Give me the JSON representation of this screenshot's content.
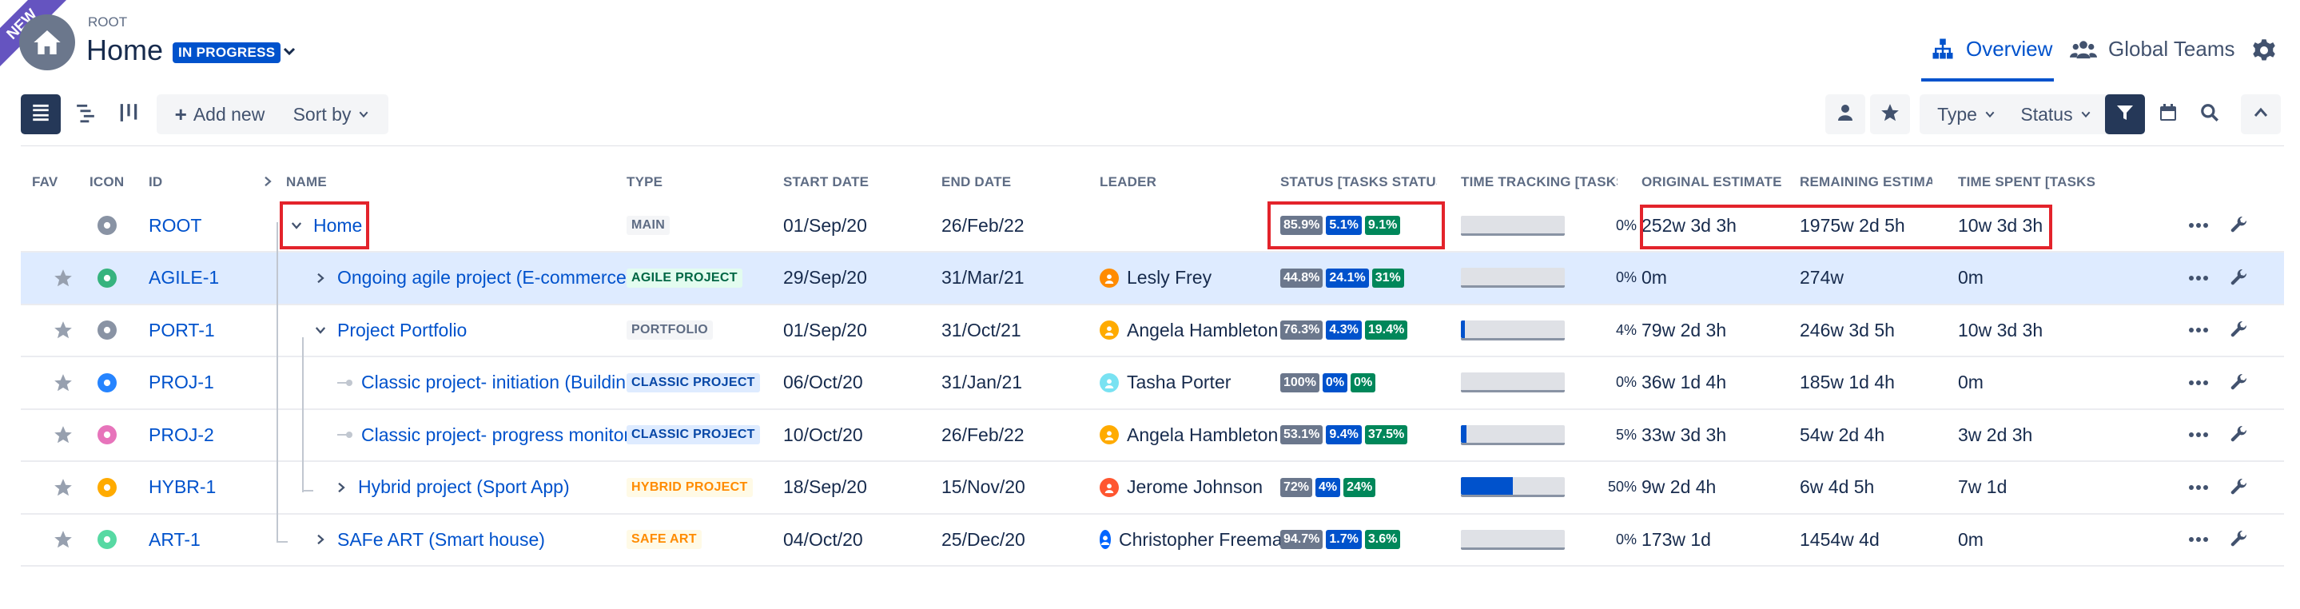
{
  "ribbon": {
    "label": "NEW"
  },
  "header": {
    "breadcrumb": "ROOT",
    "title": "Home",
    "status": "IN PROGRESS",
    "tabs": {
      "overview": "Overview",
      "global_teams": "Global Teams"
    }
  },
  "toolbar": {
    "add_new": "Add new",
    "sort_by": "Sort by",
    "type": "Type",
    "status": "Status"
  },
  "table": {
    "headers": {
      "fav": "FAV",
      "icon": "ICON",
      "id": "ID",
      "name": "NAME",
      "type": "TYPE",
      "start_date": "START DATE",
      "end_date": "END DATE",
      "leader": "LEADER",
      "status": "STATUS [TASKS STATUS",
      "time_tracking": "TIME TRACKING [TASKS",
      "original_estimate": "ORIGINAL ESTIMATE",
      "remaining_estimate": "REMAINING ESTIMAT",
      "time_spent": "TIME SPENT [TASKS"
    },
    "rows": [
      {
        "id": "ROOT",
        "name": "Home",
        "type": "MAIN",
        "start": "01/Sep/20",
        "end": "26/Feb/22",
        "leader": "",
        "status": [
          "85.9%",
          "5.1%",
          "9.1%"
        ],
        "progress": "0%",
        "progress_value": 0,
        "orig": "252w 3d 3h",
        "remaining": "1975w 2d 5h",
        "spent": "10w 3d 3h",
        "icon_color": "#8993a4"
      },
      {
        "id": "AGILE-1",
        "name": "Ongoing agile project (E-commerce p",
        "type": "AGILE PROJECT",
        "start": "29/Sep/20",
        "end": "31/Mar/21",
        "leader": "Lesly Frey",
        "status": [
          "44.8%",
          "24.1%",
          "31%"
        ],
        "progress": "0%",
        "progress_value": 0,
        "orig": "0m",
        "remaining": "274w",
        "spent": "0m",
        "icon_color": "#36b37e"
      },
      {
        "id": "PORT-1",
        "name": "Project Portfolio",
        "type": "PORTFOLIO",
        "start": "01/Sep/20",
        "end": "31/Oct/21",
        "leader": "Angela Hambleton",
        "status": [
          "76.3%",
          "4.3%",
          "19.4%"
        ],
        "progress": "4%",
        "progress_value": 4,
        "orig": "79w 2d 3h",
        "remaining": "246w 3d 5h",
        "spent": "10w 3d 3h",
        "icon_color": "#8993a4"
      },
      {
        "id": "PROJ-1",
        "name": "Classic project- initiation (Building",
        "type": "CLASSIC PROJECT",
        "start": "06/Oct/20",
        "end": "31/Jan/21",
        "leader": "Tasha Porter",
        "status": [
          "100%",
          "0%",
          "0%"
        ],
        "progress": "0%",
        "progress_value": 0,
        "orig": "36w 1d 4h",
        "remaining": "185w 1d 4h",
        "spent": "0m",
        "icon_color": "#2684ff"
      },
      {
        "id": "PROJ-2",
        "name": "Classic project- progress monitoring",
        "type": "CLASSIC PROJECT",
        "start": "10/Oct/20",
        "end": "26/Feb/22",
        "leader": "Angela Hambleton",
        "status": [
          "53.1%",
          "9.4%",
          "37.5%"
        ],
        "progress": "5%",
        "progress_value": 5,
        "orig": "33w 3d 3h",
        "remaining": "54w 2d 4h",
        "spent": "3w 2d 3h",
        "icon_color": "#e774bb"
      },
      {
        "id": "HYBR-1",
        "name": "Hybrid project (Sport App)",
        "type": "HYBRID PROJECT",
        "start": "18/Sep/20",
        "end": "15/Nov/20",
        "leader": "Jerome Johnson",
        "status": [
          "72%",
          "4%",
          "24%"
        ],
        "progress": "50%",
        "progress_value": 50,
        "orig": "9w 2d 4h",
        "remaining": "6w 4d 5h",
        "spent": "7w 1d",
        "icon_color": "#ffab00"
      },
      {
        "id": "ART-1",
        "name": "SAFe ART (Smart house)",
        "type": "SAFE ART",
        "start": "04/Oct/20",
        "end": "25/Dec/20",
        "leader": "Christopher Freeman",
        "status": [
          "94.7%",
          "1.7%",
          "3.6%"
        ],
        "progress": "0%",
        "progress_value": 0,
        "orig": "173w 1d",
        "remaining": "1454w 4d",
        "spent": "0m",
        "icon_color": "#57d9a3"
      }
    ]
  }
}
